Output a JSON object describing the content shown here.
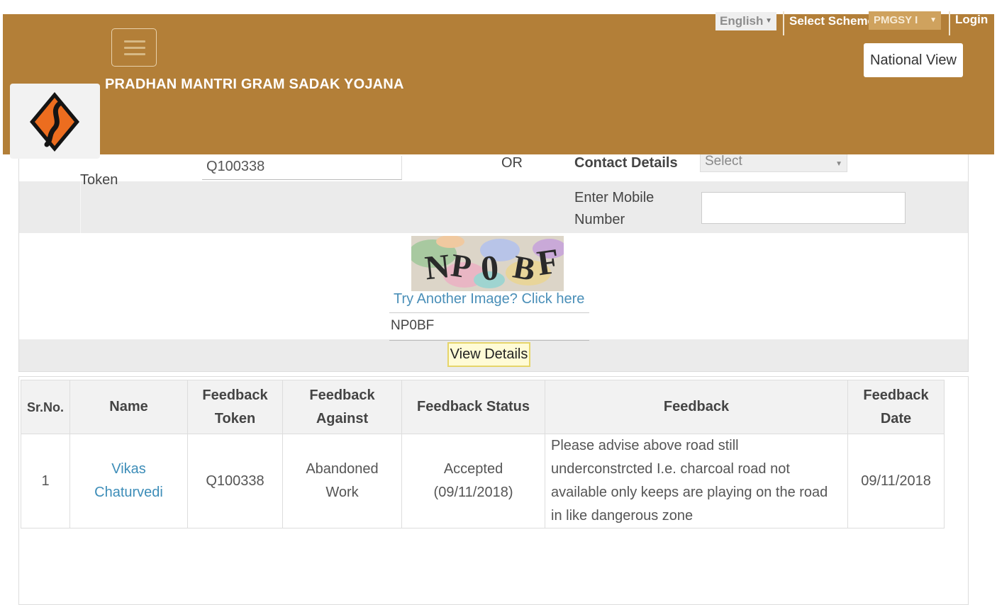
{
  "header": {
    "site_title": "PRADHAN MANTRI GRAM SADAK YOJANA",
    "language": "English",
    "scheme_label": "Select Scheme",
    "scheme_value": "PMGSY I",
    "login_label": "Login",
    "national_view_label": "National View",
    "colors": {
      "header_bg": "#b37f38",
      "logo_orange": "#ec6d1f"
    }
  },
  "form": {
    "token_label": "Token",
    "token_value": "Q100338",
    "or_label": "OR",
    "contact_label": "Contact Details",
    "contact_select_value": "Select",
    "mobile_label": "Enter Mobile Number",
    "mobile_value": "",
    "captcha_image_text": "NP0BF",
    "try_another_label": "Try Another Image? Click here",
    "captcha_input_value": "NP0BF",
    "view_details_label": "View Details"
  },
  "table": {
    "columns": [
      "Sr.No.",
      "Name",
      "Feedback Token",
      "Feedback Against",
      "Feedback Status",
      "Feedback",
      "Feedback Date"
    ],
    "rows": [
      {
        "sr": "1",
        "name": "Vikas Chaturvedi",
        "token": "Q100338",
        "against": "Abandoned Work",
        "status": "Accepted (09/11/2018)",
        "feedback": "Please advise above road still underconstrcted I.e. charcoal road not available only keeps are playing on the road in like dangerous zone",
        "date": "09/11/2018"
      }
    ]
  }
}
